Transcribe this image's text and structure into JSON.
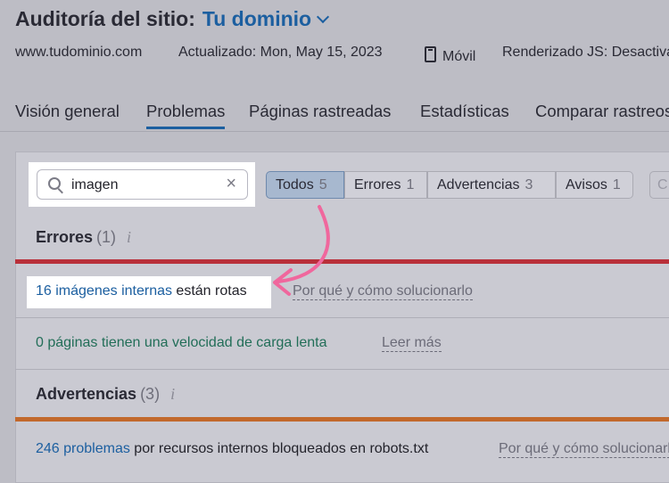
{
  "header": {
    "title": "Auditoría del sitio:",
    "domain": "Tu dominio",
    "site": "www.tudominio.com",
    "updated": "Actualizado: Mon, May 15, 2023",
    "device": "Móvil",
    "render": "Renderizado JS: Desactivado"
  },
  "tabs": [
    {
      "label": "Visión general"
    },
    {
      "label": "Problemas",
      "active": true
    },
    {
      "label": "Páginas rastreadas"
    },
    {
      "label": "Estadísticas"
    },
    {
      "label": "Comparar rastreos"
    }
  ],
  "search": {
    "value": "imagen",
    "clear": "×"
  },
  "filters": [
    {
      "label": "Todos",
      "count": "5",
      "selected": true
    },
    {
      "label": "Errores",
      "count": "1"
    },
    {
      "label": "Advertencias",
      "count": "3"
    },
    {
      "label": "Avisos",
      "count": "1"
    }
  ],
  "filters_extra": "C",
  "errors": {
    "heading": "Errores",
    "count": "(1)",
    "info": "i",
    "issue": {
      "link": "16 imágenes internas",
      "text": " están rotas",
      "help": "Por qué y cómo solucionarlo"
    },
    "ok_row": {
      "text": "0 páginas tienen una velocidad de carga lenta",
      "more": "Leer más"
    }
  },
  "warnings": {
    "heading": "Advertencias",
    "count": "(3)",
    "info": "i",
    "issue": {
      "link": "246 problemas",
      "text": " por recursos internos bloqueados en robots.txt",
      "help": "Por qué y cómo solucionarlo"
    }
  },
  "colors": {
    "accent": "#1c5fa0",
    "error": "#b9303a",
    "warning": "#c2692c",
    "annotation_arrow": "#f0679d"
  }
}
